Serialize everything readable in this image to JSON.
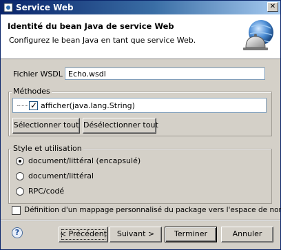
{
  "window": {
    "title": "Service Web",
    "close_glyph": "✕"
  },
  "header": {
    "title": "Identité du bean Java de service Web",
    "description": "Configurez le bean Java en tant que service Web.",
    "icon": "web-service-bell-icon"
  },
  "wsdl": {
    "label": "Fichier WSDL :",
    "value": "Echo.wsdl"
  },
  "methods": {
    "legend": "Méthodes",
    "items": [
      {
        "label": "afficher(java.lang.String)",
        "checked": true
      }
    ],
    "select_all": "Sélectionner tout",
    "deselect_all": "Désélectionner tout"
  },
  "style": {
    "legend": "Style et utilisation",
    "options": [
      {
        "label": "document/littéral (encapsulé)",
        "selected": true
      },
      {
        "label": "document/littéral",
        "selected": false
      },
      {
        "label": "RPC/codé",
        "selected": false
      }
    ]
  },
  "mapping": {
    "label": "Définition d'un mappage personnalisé du package vers l'espace de nom",
    "checked": false
  },
  "footer": {
    "help": "?",
    "back": "< Précédent",
    "next": "Suivant >",
    "finish": "Terminer",
    "cancel": "Annuler"
  }
}
